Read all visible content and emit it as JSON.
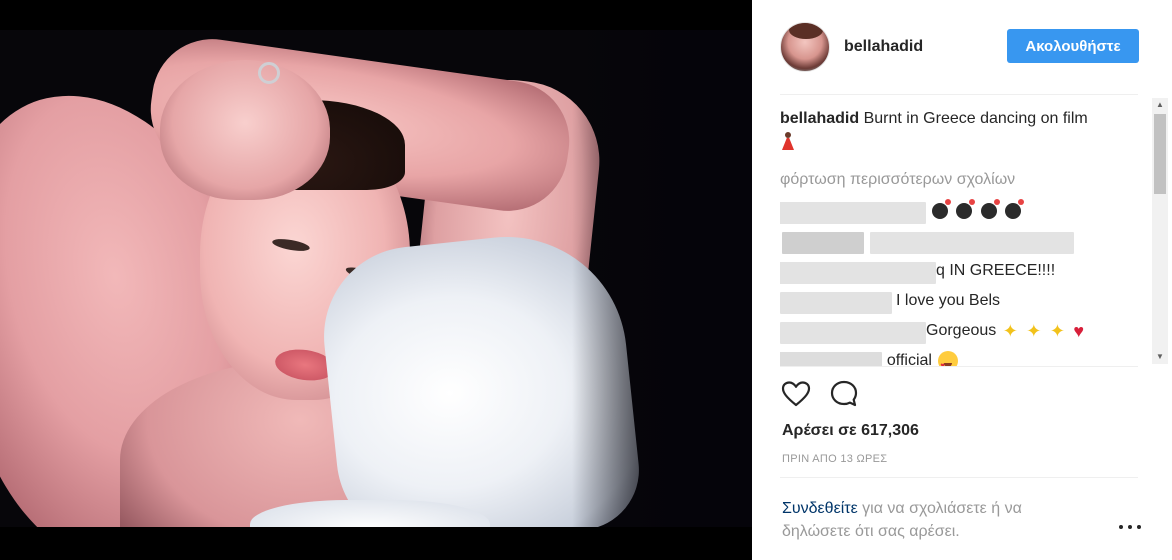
{
  "post": {
    "username": "bellahadid",
    "follow_label": "Ακολουθήστε",
    "caption_user": "bellahadid",
    "caption_text": "Burnt in Greece dancing on film",
    "load_more": "φόρτωση περισσότερων σχολίων",
    "likes": "Αρέσει σε 617,306",
    "timestamp": "ΠΡΙΝ ΑΠΟ 13 ΩΡΕΣ",
    "login_link": "Συνδεθείτε",
    "login_text": " για να σχολιάσετε ή να δηλώσετε ότι σας αρέσει."
  },
  "comments": [
    {
      "visible_text": "",
      "emojis": [
        "bomb",
        "bomb",
        "bomb",
        "bomb"
      ]
    },
    {
      "visible_text": "",
      "emojis": []
    },
    {
      "visible_text": "q IN GREECE!!!!",
      "emojis": []
    },
    {
      "visible_text": "I love you Bels",
      "emojis": []
    },
    {
      "visible_text": "Gorgeous",
      "emojis": [
        "sparkles",
        "sparkles",
        "sparkles",
        "red-heart"
      ]
    },
    {
      "visible_text": "_official",
      "emojis": [
        "heart-eyes"
      ]
    }
  ],
  "icons": {
    "like": "heart-outline-icon",
    "comment": "comment-bubble-icon",
    "more": "more-options-icon"
  },
  "colors": {
    "follow_button": "#3897f0",
    "link": "#003569",
    "muted": "#999999",
    "text": "#262626"
  }
}
